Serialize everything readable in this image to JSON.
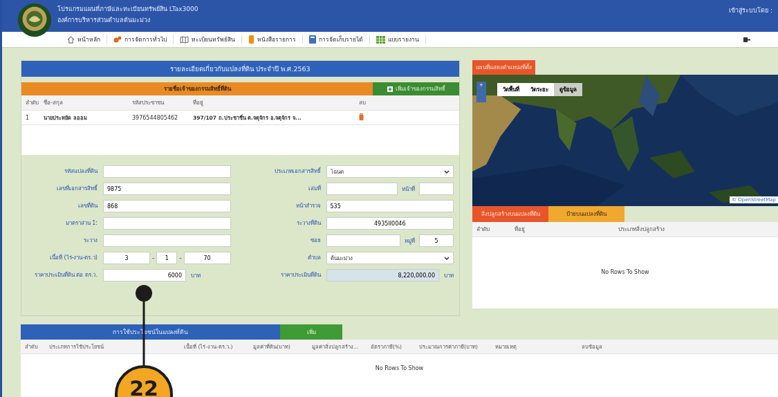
{
  "header": {
    "title": "โปรแกรมแผนที่ภาษีและทะเบียนทรัพย์สิน LTax3000",
    "subtitle": "องค์การบริหารส่วนตำบลต้นมะม่วง",
    "login": "เข้าสู่ระบบโดย :"
  },
  "menu": [
    {
      "label": "หน้าหลัก"
    },
    {
      "label": "การจัดการทั่วไป"
    },
    {
      "label": "ทะเบียนทรัพย์สิน"
    },
    {
      "label": "หนังสือรายการ"
    },
    {
      "label": "การจัดเก็บรายได้"
    },
    {
      "label": "แบบรายงาน"
    }
  ],
  "parcel": {
    "title": "รายละเอียดเกี่ยวกับแปลงที่ดิน ประจำปี พ.ศ.2563",
    "owners_title": "รายชื่อเจ้าของกรรมสิทธิ์ที่ดิน",
    "add_owner": "เพิ่มเจ้าของกรรมสิทธิ์",
    "columns": [
      "ลำดับ",
      "ชื่อ-สกุล",
      "รหัสประชาชน",
      "ที่อยู่",
      "ลบ"
    ],
    "rows": [
      {
        "no": "1",
        "name": "นายประหยัด ลออม",
        "id": "3976544805462",
        "address": "397/107 ถ.ประชาชื่น ต.จตุจักร อ.จตุจักร จ..."
      }
    ],
    "left_fields": [
      {
        "label": "รหัสแปลงที่ดิน",
        "kind": "text"
      },
      {
        "label": "เลขที่เอกสารสิทธิ์",
        "kind": "text",
        "value": "9875"
      },
      {
        "label": "เลขที่ดิน",
        "kind": "text",
        "value": "868"
      },
      {
        "label": "มาตราส่วน 1:",
        "kind": "text"
      },
      {
        "label": "ระวาง",
        "kind": "text"
      },
      {
        "label": "เนื้อที่ (ไร่-งาน-ตร.ว)",
        "kind": "triple",
        "values": [
          "3",
          "1",
          "70"
        ],
        "separators": [
          "-",
          "-"
        ]
      },
      {
        "label": "ราคาประเมินที่ดิน ต่อ ตร.ว.",
        "kind": "unit",
        "value": "6000",
        "unit": "บาท"
      }
    ],
    "right_fields": [
      {
        "label": "ประเภทเอกสารสิทธิ์",
        "kind": "select",
        "value": "โฉนด"
      },
      {
        "label": "เล่มที่",
        "kind": "pair",
        "second_label": "หน้าที่"
      },
      {
        "label": "หน้าสำรวจ",
        "kind": "text",
        "value": "535"
      },
      {
        "label": "ระวางที่ดิน",
        "kind": "center",
        "value": "4935II0046"
      },
      {
        "label": "ซอย",
        "kind": "pair",
        "second_label": "หมู่ที่",
        "second_value": "5"
      },
      {
        "label": "ตำบล",
        "kind": "select",
        "value": "ต้นมะม่วง"
      },
      {
        "label": "ราคาประเมินที่ดิน",
        "kind": "readonly",
        "value": "8,220,000.00",
        "unit": "บาท"
      }
    ]
  },
  "map": {
    "title": "แผนที่แสดงตำแหน่งที่ตั้ง",
    "tools": [
      "วัดพื้นที่",
      "วัดระยะ",
      "ดูข้อมูล"
    ],
    "zoom": "+",
    "attribution": "© OpenStreetMap",
    "tabs": [
      {
        "label": "สิ่งปลูกสร้างบนแปลงที่ดิน",
        "selected": true
      },
      {
        "label": "ป้ายบนแปลงที่ดิน",
        "selected": false
      }
    ],
    "columns": [
      "ลำดับ",
      "ที่อยู่",
      "ประเภทสิ่งปลูกสร้าง"
    ],
    "empty": "No Rows To Show"
  },
  "usage": {
    "title": "การใช้ประโยชน์ในแปลงที่ดิน",
    "add": "เพิ่ม",
    "columns": [
      "ลำดับ",
      "ประเภทการใช้ประโยชน์",
      "เนื้อที่ (ไร่-งาน-ตร.ว.)",
      "มูลค่าที่ดิน(บาท)",
      "มูลค่าสิ่งปลูกสร้าง...",
      "อัตราภาษี(%)",
      "ประมาณการค่าภาษี(บาท)",
      "หมายเหตุ",
      "ลบข้อมูล"
    ],
    "empty": "No Rows To Show"
  },
  "callout": {
    "label": "22"
  }
}
